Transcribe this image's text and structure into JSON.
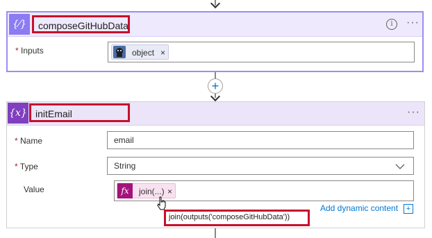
{
  "card1": {
    "icon_label": "{⁄}",
    "title": "composeGitHubData",
    "inputs_label": "Inputs",
    "required_mark": "*",
    "token_label": "object",
    "token_close": "×",
    "more": "···",
    "info": "i"
  },
  "connector": {
    "add_label": "+"
  },
  "card2": {
    "icon_label": "{x}",
    "title": "initEmail",
    "more": "···",
    "required_mark": "*",
    "name_label": "Name",
    "name_value": "email",
    "type_label": "Type",
    "type_value": "String",
    "value_label": "Value",
    "value_token": "join(...)",
    "value_token_close": "×",
    "fx_label": "fx",
    "add_dynamic": "Add dynamic content",
    "tooltip": "join(outputs('composeGitHubData'))"
  },
  "colors": {
    "compose_accent": "#8b7cf2",
    "variable_accent": "#7f3fbf",
    "highlight_red": "#c5102b",
    "link_blue": "#0078d4"
  }
}
